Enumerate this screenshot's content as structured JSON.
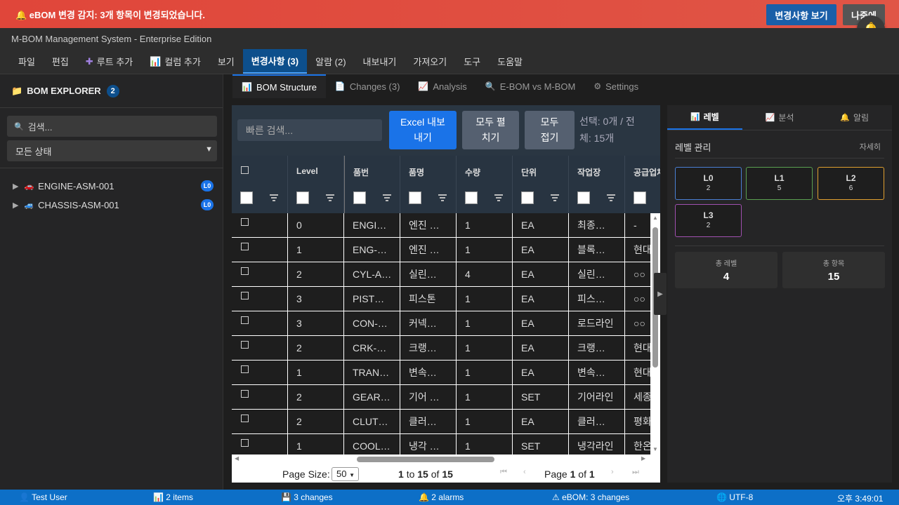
{
  "alert": {
    "text": "🔔 eBOM 변경 감지: 3개 항목이 변경되었습니다.",
    "view_button": "변경사항 보기",
    "later_button": "나중에"
  },
  "window": {
    "title": "M-BOM Management System - Enterprise Edition"
  },
  "menu": [
    {
      "icon": "",
      "label": "파일"
    },
    {
      "icon": "",
      "label": "편집"
    },
    {
      "icon": "➕",
      "label": "루트 추가"
    },
    {
      "icon": "📊",
      "label": "컬럼 추가"
    },
    {
      "icon": "",
      "label": "보기"
    },
    {
      "icon": "",
      "label": "변경사항 (3)"
    },
    {
      "icon": "",
      "label": "알람 (2)"
    },
    {
      "icon": "",
      "label": "내보내기"
    },
    {
      "icon": "",
      "label": "가져오기"
    },
    {
      "icon": "",
      "label": "도구"
    },
    {
      "icon": "",
      "label": "도움말"
    }
  ],
  "sidebar": {
    "title": "BOM EXPLORER",
    "count": "2",
    "search_placeholder": "검색...",
    "status_select": "모든 상태",
    "tree": [
      {
        "label": "ENGINE-ASM-001",
        "level": "L0",
        "icon": "car-red-icon"
      },
      {
        "label": "CHASSIS-ASM-001",
        "level": "L0",
        "icon": "car-blue-icon"
      }
    ]
  },
  "tabs": [
    {
      "icon": "📊",
      "label": "BOM Structure"
    },
    {
      "icon": "📄",
      "label": "Changes (3)"
    },
    {
      "icon": "📈",
      "label": "Analysis"
    },
    {
      "icon": "🔍",
      "label": "E-BOM vs M-BOM"
    },
    {
      "icon": "⚙",
      "label": "Settings"
    }
  ],
  "toolbar": {
    "search_placeholder": "빠른 검색...",
    "excel_line1": "Excel 내보",
    "excel_line2": "내기",
    "expand_line1": "모두 펼",
    "expand_line2": "치기",
    "collapse_line1": "모두",
    "collapse_line2": "접기",
    "selection_line1": "선택: 0개 / 전",
    "selection_line2": "체: 15개"
  },
  "grid": {
    "columns": [
      "",
      "Level",
      "품번",
      "품명",
      "수량",
      "단위",
      "작업장",
      "공급업체"
    ],
    "rows": [
      [
        "0",
        "ENGI…",
        "엔진 …",
        "1",
        "EA",
        "최종…",
        "-"
      ],
      [
        "1",
        "ENG-…",
        "엔진 …",
        "1",
        "EA",
        "블록…",
        "현대"
      ],
      [
        "2",
        "CYL-A…",
        "실린…",
        "4",
        "EA",
        "실린…",
        "○○"
      ],
      [
        "3",
        "PIST…",
        "피스톤",
        "1",
        "EA",
        "피스…",
        "○○"
      ],
      [
        "3",
        "CON-…",
        "커넥…",
        "1",
        "EA",
        "로드라인",
        "○○"
      ],
      [
        "2",
        "CRK-…",
        "크랭…",
        "1",
        "EA",
        "크랭…",
        "현대"
      ],
      [
        "1",
        "TRAN…",
        "변속…",
        "1",
        "EA",
        "변속…",
        "현대"
      ],
      [
        "2",
        "GEAR…",
        "기어 …",
        "1",
        "SET",
        "기어라인",
        "세종"
      ],
      [
        "2",
        "CLUT…",
        "클러…",
        "1",
        "EA",
        "클러…",
        "평화"
      ],
      [
        "1",
        "COOL…",
        "냉각 …",
        "1",
        "SET",
        "냉각라인",
        "한온"
      ]
    ]
  },
  "pager": {
    "page_size_label": "Page Size:",
    "page_size": "50",
    "range_from": "1",
    "range_to": "15",
    "range_total": "15",
    "to_word": "to",
    "of_word": "of",
    "page_word": "Page",
    "page_current": "1",
    "page_total": "1"
  },
  "right_panel": {
    "tabs": [
      {
        "icon": "📊",
        "label": "레벨"
      },
      {
        "icon": "📈",
        "label": "분석"
      },
      {
        "icon": "🔔",
        "label": "알림"
      }
    ],
    "title": "레벨 관리",
    "more": "자세히",
    "levels": [
      {
        "name": "L0",
        "count": "2",
        "color": "#4a7fd4"
      },
      {
        "name": "L1",
        "count": "5",
        "color": "#5aa050"
      },
      {
        "name": "L2",
        "count": "6",
        "color": "#e0a030"
      },
      {
        "name": "L3",
        "count": "2",
        "color": "#a050b0"
      }
    ],
    "stats": [
      {
        "label": "총 레벨",
        "value": "4"
      },
      {
        "label": "총 항목",
        "value": "15"
      }
    ]
  },
  "statusbar": {
    "user": "Test User",
    "items": "2 items",
    "changes": "3 changes",
    "alarms": "2 alarms",
    "ebom": "eBOM: 3 changes",
    "encoding": "UTF-8",
    "time": "오후 3:49:01"
  }
}
